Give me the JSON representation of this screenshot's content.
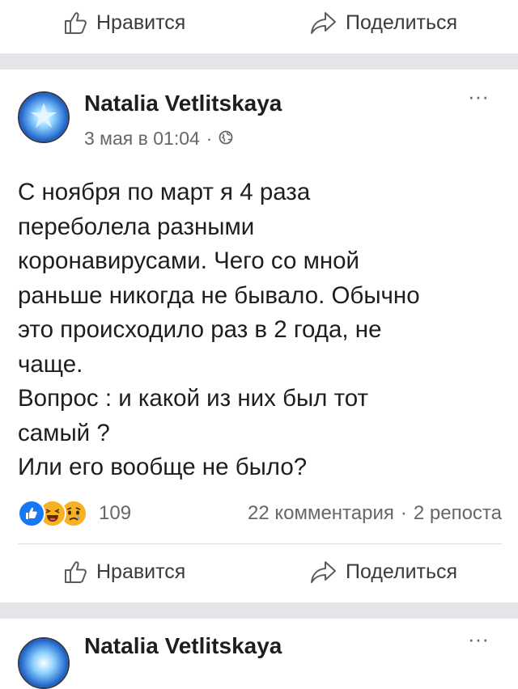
{
  "top_actions": {
    "like_label": "Нравится",
    "share_label": "Поделиться"
  },
  "post": {
    "author": "Natalia Vetlitskaya",
    "date": "3 мая в 01:04",
    "separator": "·",
    "more": "···",
    "text_lines": [
      "С ноября по март я 4 раза",
      "переболела разными",
      "коронавирусами. Чего со мной",
      "раньше никогда не бывало. Обычно",
      "это происходило раз в 2 года, не",
      "чаще.",
      "Вопрос : и какой из них был тот",
      "самый ?",
      "Или его вообще не было?"
    ],
    "reaction_icons": [
      "like-icon",
      "haha-icon",
      "sad-icon"
    ],
    "reactions_count": "109",
    "comments": "22 комментария",
    "reposts": "2 репоста",
    "like_label": "Нравится",
    "share_label": "Поделиться"
  },
  "next_post": {
    "author": "Natalia Vetlitskaya",
    "more": "···"
  },
  "colors": {
    "background": "#ffffff",
    "separator": "#e4e5e9",
    "text": "#1c1e21",
    "secondary_text": "#65676b",
    "like_blue": "#1877f2",
    "reaction_yellow": "#f7b125"
  }
}
